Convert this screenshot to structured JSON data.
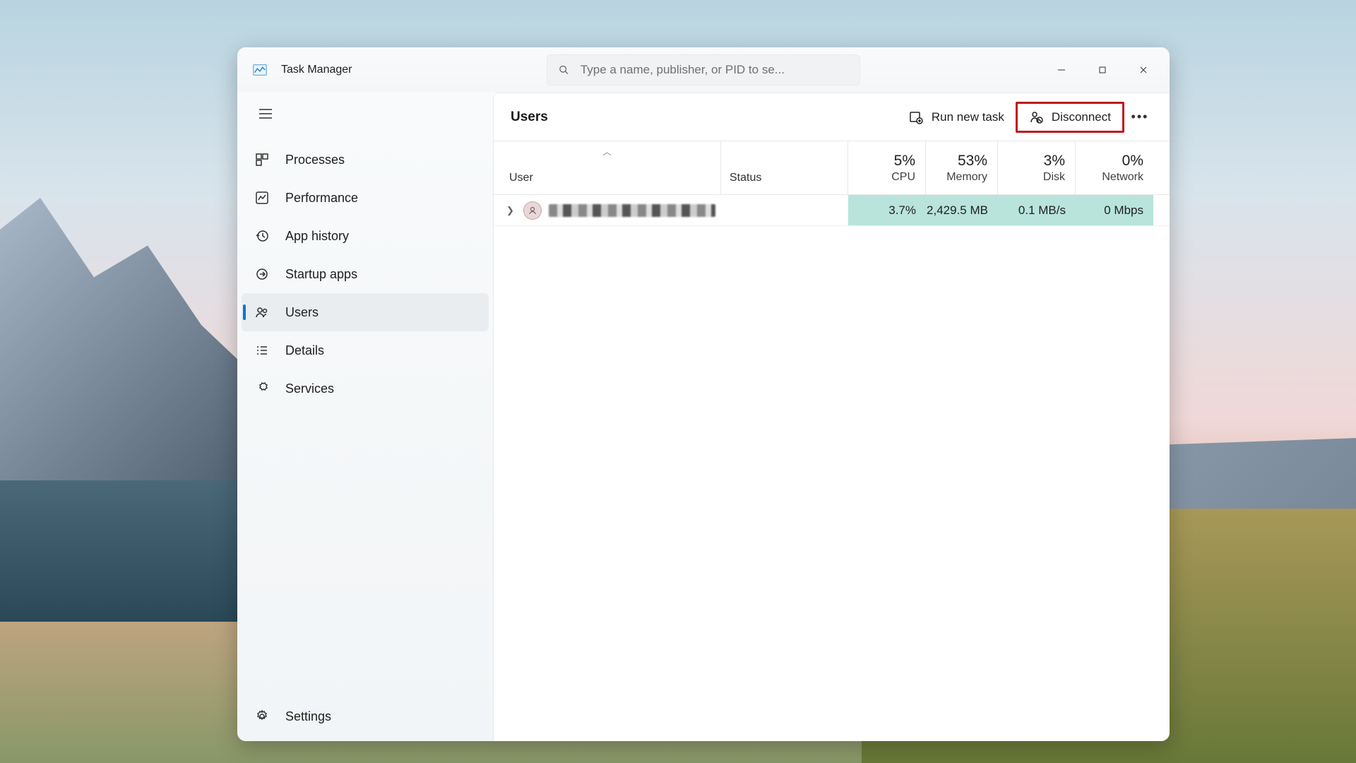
{
  "app": {
    "title": "Task Manager"
  },
  "search": {
    "placeholder": "Type a name, publisher, or PID to se..."
  },
  "sidebar": {
    "items": [
      {
        "label": "Processes"
      },
      {
        "label": "Performance"
      },
      {
        "label": "App history"
      },
      {
        "label": "Startup apps"
      },
      {
        "label": "Users"
      },
      {
        "label": "Details"
      },
      {
        "label": "Services"
      }
    ],
    "settings_label": "Settings"
  },
  "toolbar": {
    "page_title": "Users",
    "run_new_task": "Run new task",
    "disconnect": "Disconnect"
  },
  "table": {
    "headers": {
      "user": "User",
      "status": "Status",
      "cpu_pct": "5%",
      "cpu_lbl": "CPU",
      "mem_pct": "53%",
      "mem_lbl": "Memory",
      "disk_pct": "3%",
      "disk_lbl": "Disk",
      "net_pct": "0%",
      "net_lbl": "Network"
    },
    "row": {
      "status": "",
      "cpu": "3.7%",
      "mem": "2,429.5 MB",
      "disk": "0.1 MB/s",
      "net": "0 Mbps"
    }
  }
}
